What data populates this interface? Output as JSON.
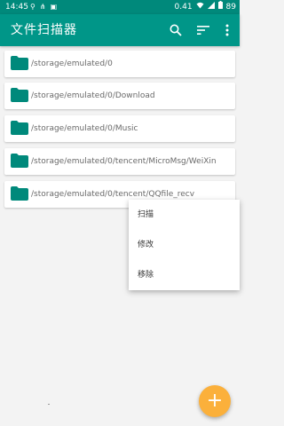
{
  "status": {
    "time": "14:45",
    "network_speed": "0.41",
    "battery": "89",
    "icons": [
      "usb-icon",
      "share-icon",
      "image-icon",
      "wifi-icon",
      "signal-icon",
      "battery-icon"
    ]
  },
  "appbar": {
    "title": "文件扫描器",
    "actions": [
      "search-icon",
      "sort-icon",
      "more-vert-icon"
    ]
  },
  "folders": [
    "/storage/emulated/0",
    "/storage/emulated/0/Download",
    "/storage/emulated/0/Music",
    "/storage/emulated/0/tencent/MicroMsg/WeiXin",
    "/storage/emulated/0/tencent/QQfile_recv"
  ],
  "menu": {
    "items": [
      "扫描",
      "修改",
      "移除"
    ]
  },
  "fab": {
    "label": "+"
  },
  "colors": {
    "primary": "#009688",
    "primary_dark": "#00897b",
    "folder": "#00897b",
    "fab": "#fbb03b",
    "background": "#f3f3f3"
  }
}
